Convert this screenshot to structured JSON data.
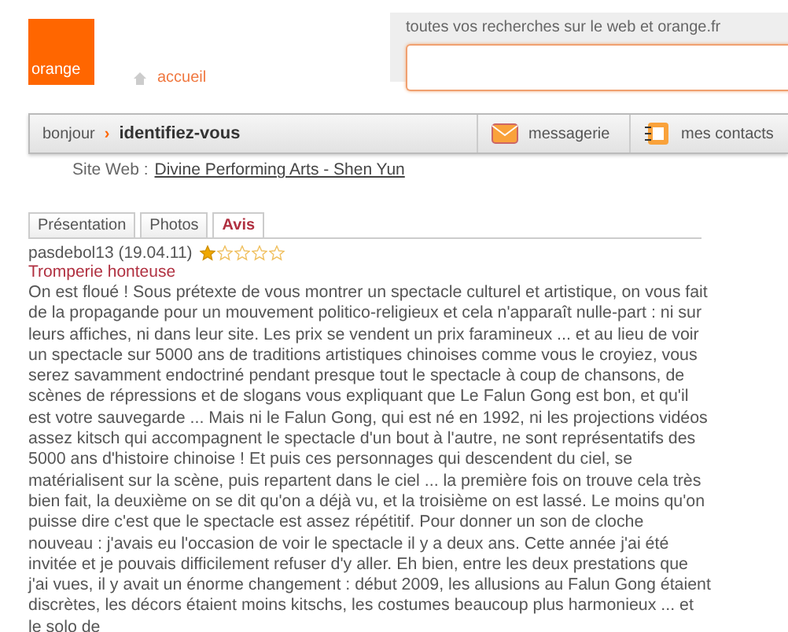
{
  "header": {
    "logo": "orange",
    "home_link": "accueil",
    "search_label": "toutes vos recherches sur le web et orange.fr"
  },
  "nav": {
    "greeting": "bonjour",
    "separator": "›",
    "login": "identifiez-vous",
    "mail": "messagerie",
    "contacts": "mes contacts"
  },
  "site": {
    "label": "Site Web :",
    "link": "Divine Performing Arts - Shen Yun"
  },
  "tabs": [
    {
      "label": "Présentation",
      "selected": false
    },
    {
      "label": "Photos",
      "selected": false
    },
    {
      "label": "Avis",
      "selected": true
    }
  ],
  "review": {
    "author": "pasdebol13 (19.04.11)",
    "stars": 1,
    "title": "Tromperie honteuse",
    "text": "On est floué ! Sous prétexte de vous montrer un spectacle culturel et artistique, on vous fait de la propagande pour un mouvement politico-religieux et cela n'apparaît nulle-part : ni sur leurs affiches, ni dans leur site. Les prix se vendent un prix faramineux ... et au lieu de voir un spectacle sur 5000 ans de traditions artistiques chinoises comme vous le croyiez, vous serez savamment endoctriné pendant presque tout le spectacle à coup de chansons, de scènes de répressions et de slogans vous expliquant que Le Falun Gong est bon, et qu'il est votre sauvegarde ... Mais ni le Falun Gong, qui est né en 1992, ni les projections vidéos assez kitsch qui accompagnent le spectacle d'un bout à l'autre, ne sont représentatifs des 5000 ans d'histoire chinoise ! Et puis ces personnages qui descendent du ciel, se matérialisent sur la scène, puis repartent dans le ciel ... la première fois on trouve cela très bien fait, la deuxième on se dit qu'on a déjà vu, et la troisième on est lassé. Le moins qu'on puisse dire c'est que le spectacle est assez répétitif. Pour donner un son de cloche nouveau : j'avais eu l'occasion de voir le spectacle il y a deux ans. Cette année j'ai été invitée et je pouvais difficilement refuser d'y aller. Eh bien, entre les deux prestations que j'ai vues, il y avait un énorme changement : début 2009, les allusions au Falun Gong étaient discrètes, les décors étaient moins kitschs, les costumes beaucoup plus harmonieux ... et le solo de"
  }
}
